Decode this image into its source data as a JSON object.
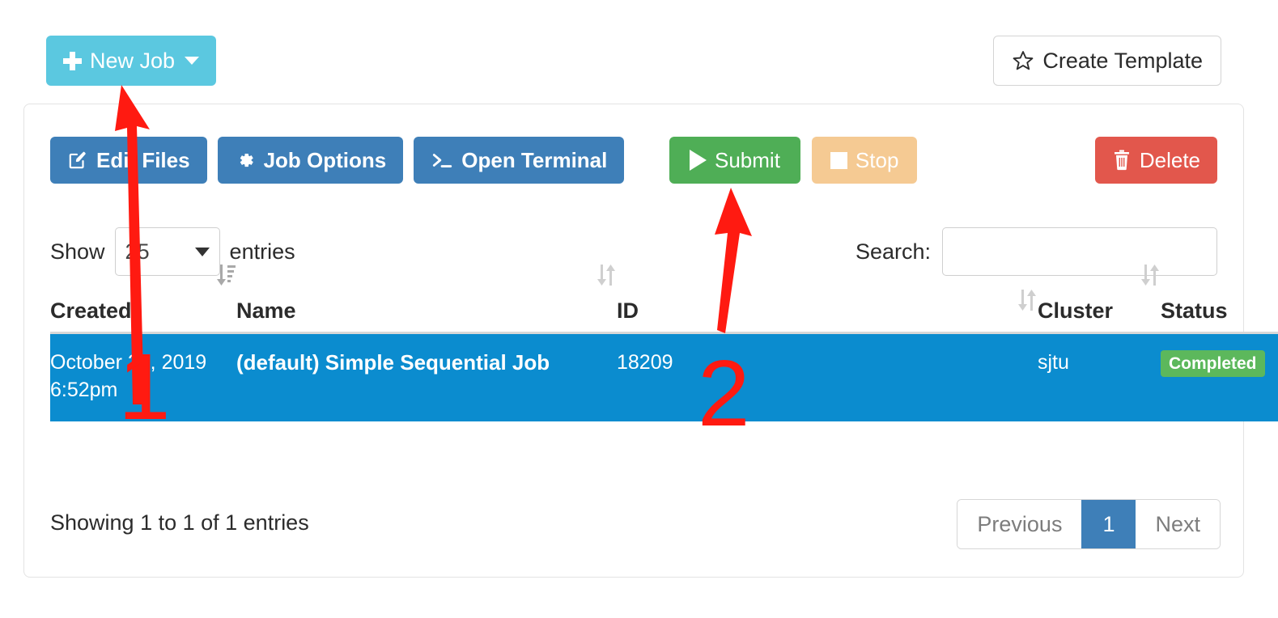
{
  "toolbar_top": {
    "new_job_label": "New Job",
    "create_template_label": "Create Template"
  },
  "actions": {
    "edit_files_label": "Edit Files",
    "job_options_label": "Job Options",
    "open_terminal_label": "Open Terminal",
    "submit_label": "Submit",
    "stop_label": "Stop",
    "delete_label": "Delete"
  },
  "controls": {
    "show_prefix": "Show",
    "show_value": "25",
    "show_suffix": "entries",
    "search_label": "Search:",
    "search_value": "",
    "search_placeholder": ""
  },
  "table": {
    "columns": [
      {
        "label": "Created",
        "sort": "desc"
      },
      {
        "label": "Name",
        "sort": "none"
      },
      {
        "label": "ID",
        "sort": "none"
      },
      {
        "label": "",
        "sort": "none"
      },
      {
        "label": "Cluster",
        "sort": "none"
      },
      {
        "label": "Status",
        "sort": "none"
      }
    ],
    "rows": [
      {
        "created": "October 28, 2019 6:52pm",
        "name": "(default) Simple Sequential Job",
        "id": "18209",
        "blank": "",
        "cluster": "sjtu",
        "status": "Completed",
        "selected": true
      }
    ]
  },
  "footer": {
    "showing_info": "Showing 1 to 1 of 1 entries",
    "previous_label": "Previous",
    "page_label": "1",
    "next_label": "Next"
  },
  "annotations": {
    "step_one": "1",
    "step_two": "2"
  },
  "colors": {
    "new_job": "#5bc8e0",
    "primary_blue": "#3e7fb8",
    "submit_green": "#4fae56",
    "stop_orange": "#f5ca93",
    "delete_red": "#e2574c",
    "row_selected": "#0b8ccf",
    "badge_green": "#5cb85c",
    "annotation_red": "#ff1a11"
  }
}
